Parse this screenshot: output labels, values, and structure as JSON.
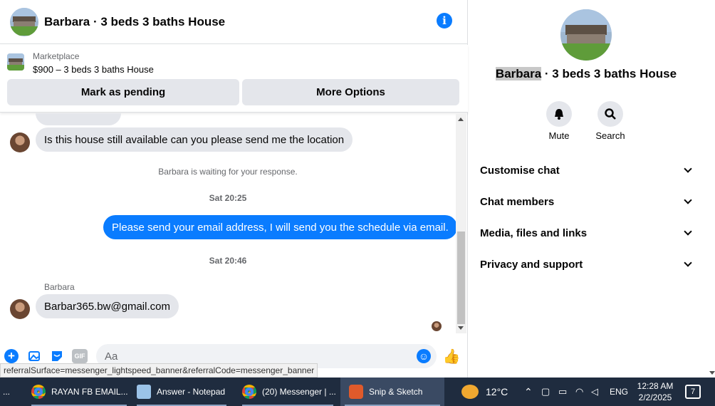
{
  "header": {
    "title": "Barbara · 3 beds 3 baths House",
    "info_icon": "info-icon"
  },
  "listing": {
    "source": "Marketplace",
    "title": "$900 – 3 beds 3 baths House",
    "pending_label": "Mark as pending",
    "more_label": "More Options"
  },
  "messages": {
    "incoming_1": "Is this house still available can you please send me the location",
    "system": "Barbara is waiting for your response.",
    "time_1": "Sat 20:25",
    "outgoing_1": "Please send your email address, I will send you the schedule via email.",
    "time_2": "Sat 20:46",
    "sender": "Barbara",
    "incoming_2": "Barbar365.bw@gmail.com"
  },
  "composer": {
    "placeholder": "Aa",
    "gif_label": "GIF"
  },
  "status_url": "referralSurface=messenger_lightspeed_banner&referralCode=messenger_banner",
  "panel": {
    "name_highlight": "Barbara",
    "name_rest": " · 3 beds 3 baths House",
    "mute_label": "Mute",
    "search_label": "Search",
    "sections": [
      "Customise chat",
      "Chat members",
      "Media, files and links",
      "Privacy and support"
    ]
  },
  "taskbar": {
    "start_partial": "...",
    "items": [
      "RAYAN FB EMAIL...",
      "Answer - Notepad",
      "(20) Messenger | ...",
      "Snip & Sketch"
    ],
    "temperature": "12°C",
    "language": "ENG",
    "time": "12:28 AM",
    "date": "2/2/2025",
    "notifications": "7"
  },
  "colors": {
    "accent": "#0a7cff",
    "bubble_in": "#e4e6eb",
    "taskbar": "#1f2c3f"
  }
}
